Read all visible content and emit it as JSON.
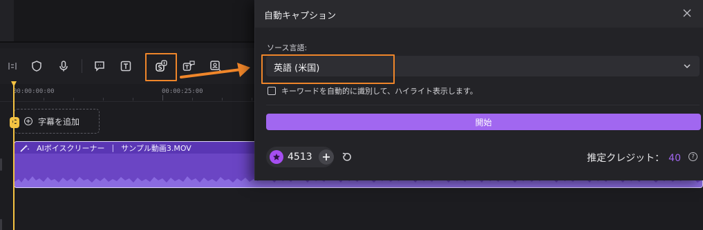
{
  "timeline": {
    "ruler": {
      "tick_start": "00:00:00:00",
      "tick_mid": "00:00:25:00"
    },
    "subtitle_track": {
      "add_label": "字幕を追加",
      "badge": "C"
    },
    "audio_clip": {
      "effect": "AIボイスクリーナー",
      "separator": "|",
      "name": "サンプル動画3.MOV"
    }
  },
  "toolbar": {
    "icons": [
      "split-icon",
      "shield-icon",
      "microphone-icon",
      "comment-icon",
      "text-icon",
      "auto-caption-icon",
      "text-to-speech-icon",
      "speech-to-text-icon"
    ]
  },
  "dialog": {
    "title": "自動キャプション",
    "source_language_label": "ソース言語:",
    "source_language_value": "英語 (米国)",
    "highlight_checkbox_label": "キーワードを自動的に識別して、ハイライト表示します。",
    "start_button": "開始",
    "credits_balance": "4513",
    "estimate_label": "推定クレジット：",
    "estimate_value": "40",
    "help_glyph": "?"
  },
  "colors": {
    "accent": "#a167f0",
    "highlight": "#f0862a",
    "playhead": "#f5c342",
    "clip": "#6b45c4"
  }
}
